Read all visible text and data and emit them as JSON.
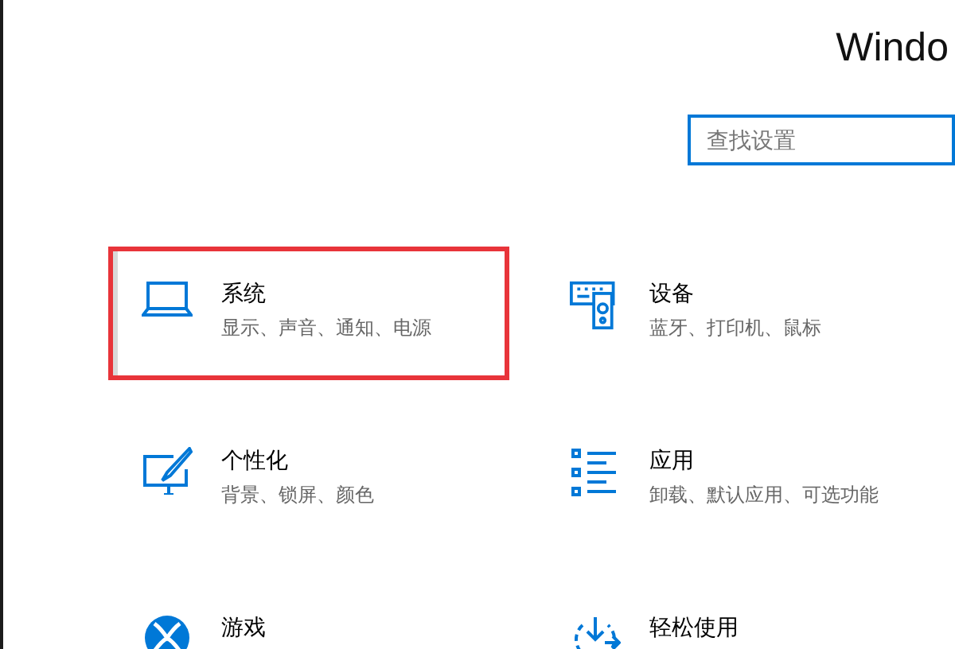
{
  "window": {
    "title": "Windo"
  },
  "search": {
    "placeholder": "查找设置",
    "focused": true
  },
  "categories": [
    {
      "kind": "laptop",
      "title": "系统",
      "subtitle": "显示、声音、通知、电源",
      "selected": true
    },
    {
      "kind": "devices",
      "title": "设备",
      "subtitle": "蓝牙、打印机、鼠标",
      "selected": false
    },
    {
      "kind": "personalize",
      "title": "个性化",
      "subtitle": "背景、锁屏、颜色",
      "selected": false
    },
    {
      "kind": "apps",
      "title": "应用",
      "subtitle": "卸载、默认应用、可选功能",
      "selected": false
    },
    {
      "kind": "gaming",
      "title": "游戏",
      "selected": false
    },
    {
      "kind": "access",
      "title": "轻松使用",
      "selected": false
    }
  ]
}
